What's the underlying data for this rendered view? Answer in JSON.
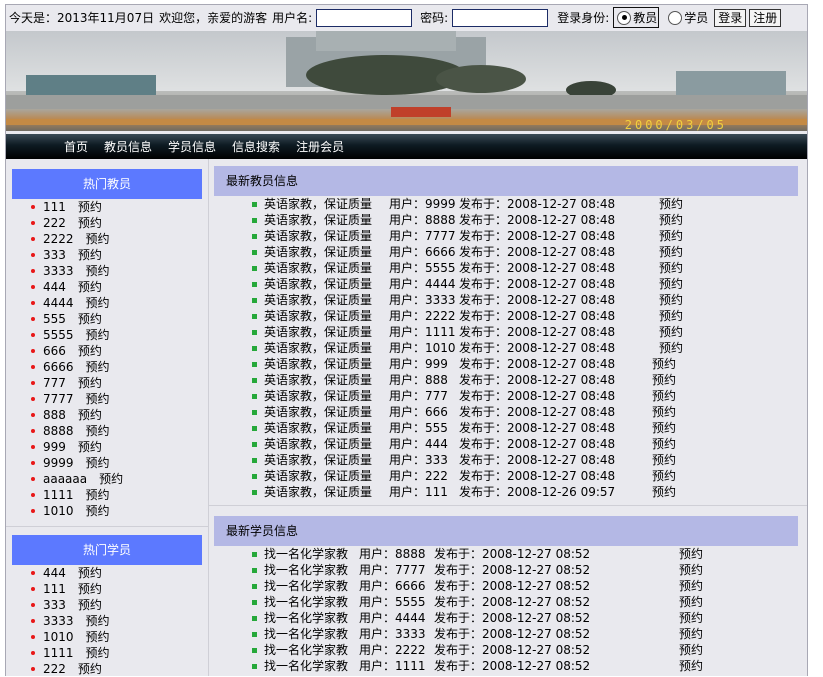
{
  "topbar": {
    "date_text": "今天是：2013年11月07日",
    "welcome_text": "欢迎您，亲爱的游客",
    "username_label": "用户名:",
    "username_value": "",
    "password_label": "密码:",
    "password_value": "",
    "role_label": "登录身份:",
    "role_teacher": "教员",
    "role_student": "学员",
    "selected_role": "教员",
    "login_button": "登录",
    "register_button": "注册"
  },
  "banner": {
    "date_stamp": "2000/03/05"
  },
  "nav": {
    "items": [
      "首页",
      "教员信息",
      "学员信息",
      "信息搜索",
      "注册会员"
    ]
  },
  "hot_teachers": {
    "title": "热门教员",
    "action": "预约",
    "items": [
      "111",
      "222",
      "2222",
      "333",
      "3333",
      "444",
      "4444",
      "555",
      "5555",
      "666",
      "6666",
      "777",
      "7777",
      "888",
      "8888",
      "999",
      "9999",
      "aaaaaa",
      "1111",
      "1010"
    ]
  },
  "hot_students": {
    "title": "热门学员",
    "action": "预约",
    "items": [
      "444",
      "111",
      "333",
      "3333",
      "1010",
      "1111",
      "222"
    ]
  },
  "latest_teachers": {
    "title": "最新教员信息",
    "user_label": "用户：",
    "posted_label": "发布于：",
    "action": "预约",
    "rows": [
      {
        "title": "英语家教，保证质量",
        "user": "9999",
        "time": "2008-12-27 08:48"
      },
      {
        "title": "英语家教，保证质量",
        "user": "8888",
        "time": "2008-12-27 08:48"
      },
      {
        "title": "英语家教，保证质量",
        "user": "7777",
        "time": "2008-12-27 08:48"
      },
      {
        "title": "英语家教，保证质量",
        "user": "6666",
        "time": "2008-12-27 08:48"
      },
      {
        "title": "英语家教，保证质量",
        "user": "5555",
        "time": "2008-12-27 08:48"
      },
      {
        "title": "英语家教，保证质量",
        "user": "4444",
        "time": "2008-12-27 08:48"
      },
      {
        "title": "英语家教，保证质量",
        "user": "3333",
        "time": "2008-12-27 08:48"
      },
      {
        "title": "英语家教，保证质量",
        "user": "2222",
        "time": "2008-12-27 08:48"
      },
      {
        "title": "英语家教，保证质量",
        "user": "1111",
        "time": "2008-12-27 08:48"
      },
      {
        "title": "英语家教，保证质量",
        "user": "1010",
        "time": "2008-12-27 08:48"
      },
      {
        "title": "英语家教，保证质量",
        "user": "999",
        "time": "2008-12-27 08:48"
      },
      {
        "title": "英语家教，保证质量",
        "user": "888",
        "time": "2008-12-27 08:48"
      },
      {
        "title": "英语家教，保证质量",
        "user": "777",
        "time": "2008-12-27 08:48"
      },
      {
        "title": "英语家教，保证质量",
        "user": "666",
        "time": "2008-12-27 08:48"
      },
      {
        "title": "英语家教，保证质量",
        "user": "555",
        "time": "2008-12-27 08:48"
      },
      {
        "title": "英语家教，保证质量",
        "user": "444",
        "time": "2008-12-27 08:48"
      },
      {
        "title": "英语家教，保证质量",
        "user": "333",
        "time": "2008-12-27 08:48"
      },
      {
        "title": "英语家教，保证质量",
        "user": "222",
        "time": "2008-12-27 08:48"
      },
      {
        "title": "英语家教，保证质量",
        "user": "111",
        "time": "2008-12-26 09:57"
      }
    ]
  },
  "latest_students": {
    "title": "最新学员信息",
    "user_label": "用户：",
    "posted_label": "发布于：",
    "action": "预约",
    "rows": [
      {
        "title": "找一名化学家教",
        "user": "8888",
        "time": "2008-12-27 08:52"
      },
      {
        "title": "找一名化学家教",
        "user": "7777",
        "time": "2008-12-27 08:52"
      },
      {
        "title": "找一名化学家教",
        "user": "6666",
        "time": "2008-12-27 08:52"
      },
      {
        "title": "找一名化学家教",
        "user": "5555",
        "time": "2008-12-27 08:52"
      },
      {
        "title": "找一名化学家教",
        "user": "4444",
        "time": "2008-12-27 08:52"
      },
      {
        "title": "找一名化学家教",
        "user": "3333",
        "time": "2008-12-27 08:52"
      },
      {
        "title": "找一名化学家教",
        "user": "2222",
        "time": "2008-12-27 08:52"
      },
      {
        "title": "找一名化学家教",
        "user": "1111",
        "time": "2008-12-27 08:52"
      }
    ]
  },
  "colors": {
    "accent_blue": "#5c79ff",
    "section_header": "#b4b8e5",
    "nav_dark": "#0d1a22",
    "bullet_red": "#e81818",
    "bullet_green": "#26a83a"
  }
}
